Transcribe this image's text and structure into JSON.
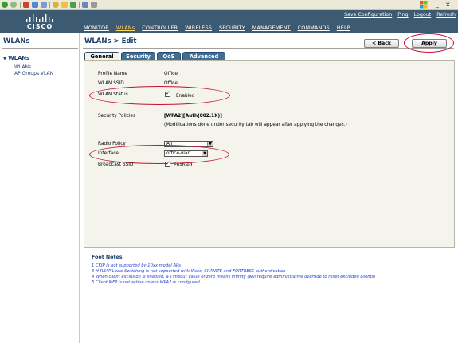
{
  "browser": {
    "window_controls": [
      "_",
      "×"
    ]
  },
  "header": {
    "logo_text": "CISCO",
    "top_links": [
      "Save Configuration",
      "Ping",
      "Logout",
      "Refresh"
    ],
    "nav": [
      "MONITOR",
      "WLANs",
      "CONTROLLER",
      "WIRELESS",
      "SECURITY",
      "MANAGEMENT",
      "COMMANDS",
      "HELP"
    ],
    "active_nav_index": 1,
    "colors": {
      "bar": "#3c5a72",
      "active_nav": "#ffd966"
    }
  },
  "sidebar": {
    "title": "WLANs",
    "root": "WLANs",
    "children": [
      "WLANs",
      "AP Groups VLAN"
    ]
  },
  "page": {
    "title": "WLANs > Edit",
    "back_label": "< Back",
    "apply_label": "Apply"
  },
  "tabs": [
    "General",
    "Security",
    "QoS",
    "Advanced"
  ],
  "active_tab": "General",
  "form": {
    "profile_name_label": "Profile Name",
    "profile_name_value": "Office",
    "ssid_label": "WLAN SSID",
    "ssid_value": "Office",
    "status_label": "WLAN Status",
    "status_checked": true,
    "status_text": "Enabled",
    "security_label": "Security Policies",
    "security_value": "[WPA2][Auth(802.1X)]",
    "security_note": "(Modifications done under security tab will appear after applying the changes.)",
    "radio_policy_label": "Radio Policy",
    "radio_policy_value": "All",
    "interface_label": "Interface",
    "interface_value": "office-vlan",
    "broadcast_label": "Broadcast SSID",
    "broadcast_checked": true,
    "broadcast_text": "Enabled"
  },
  "footnotes": {
    "title": "Foot Notes",
    "items": [
      "1 CKIP is not supported by 10xx model APs",
      "3 H-REAP Local Switching is not supported with IPsec, CRANITE and FORTRESS authentication",
      "4 When client exclusion is enabled, a Timeout Value of zero means infinity (will require administrative override to reset excluded clients)",
      "5 Client MFP is not active unless WPA2 is configured"
    ]
  },
  "icons": [
    "back-arrow-icon",
    "forward-arrow-icon",
    "stop-icon",
    "refresh-icon",
    "home-icon",
    "search-icon",
    "favorites-icon",
    "history-icon",
    "mail-icon",
    "print-icon",
    "windows-flag-icon",
    "checkmark-icon",
    "dropdown-arrow-icon"
  ]
}
